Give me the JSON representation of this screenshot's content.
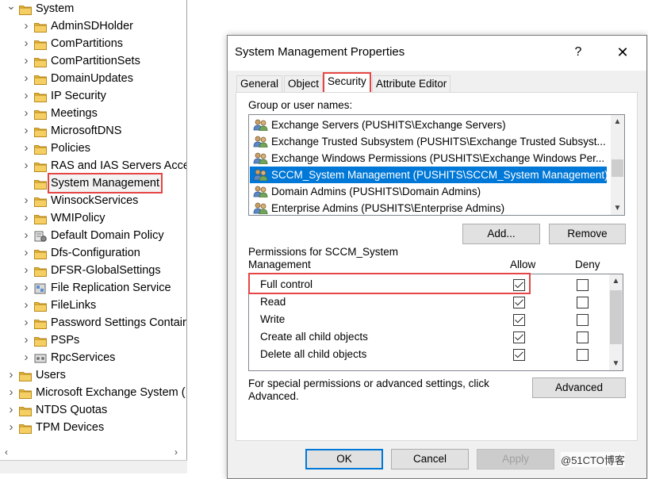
{
  "tree": {
    "items": [
      {
        "label": "System",
        "icon": "folder-icon",
        "expander": "expanded"
      },
      {
        "label": "AdminSDHolder",
        "icon": "folder-icon",
        "expander": "collapsed"
      },
      {
        "label": "ComPartitions",
        "icon": "folder-icon",
        "expander": "collapsed"
      },
      {
        "label": "ComPartitionSets",
        "icon": "folder-icon",
        "expander": "collapsed"
      },
      {
        "label": "DomainUpdates",
        "icon": "folder-icon",
        "expander": "collapsed"
      },
      {
        "label": "IP Security",
        "icon": "folder-icon",
        "expander": "collapsed"
      },
      {
        "label": "Meetings",
        "icon": "folder-icon",
        "expander": "collapsed"
      },
      {
        "label": "MicrosoftDNS",
        "icon": "folder-icon",
        "expander": "collapsed"
      },
      {
        "label": "Policies",
        "icon": "folder-icon",
        "expander": "collapsed"
      },
      {
        "label": "RAS and IAS Servers Acce",
        "icon": "folder-icon",
        "expander": "collapsed"
      },
      {
        "label": "System Management",
        "icon": "folder-icon",
        "expander": "none",
        "selected": true
      },
      {
        "label": "WinsockServices",
        "icon": "folder-icon",
        "expander": "collapsed"
      },
      {
        "label": "WMIPolicy",
        "icon": "folder-icon",
        "expander": "collapsed"
      },
      {
        "label": "Default Domain Policy",
        "icon": "policy-icon",
        "expander": "collapsed"
      },
      {
        "label": "Dfs-Configuration",
        "icon": "folder-icon",
        "expander": "collapsed"
      },
      {
        "label": "DFSR-GlobalSettings",
        "icon": "folder-icon",
        "expander": "collapsed"
      },
      {
        "label": "File Replication Service",
        "icon": "replication-icon",
        "expander": "collapsed"
      },
      {
        "label": "FileLinks",
        "icon": "folder-icon",
        "expander": "collapsed"
      },
      {
        "label": "Password Settings Contair",
        "icon": "folder-icon",
        "expander": "collapsed"
      },
      {
        "label": "PSPs",
        "icon": "folder-icon",
        "expander": "collapsed"
      },
      {
        "label": "RpcServices",
        "icon": "rpc-icon",
        "expander": "collapsed"
      },
      {
        "label": "Users",
        "icon": "folder-icon",
        "expander": "collapsed"
      },
      {
        "label": "Microsoft Exchange System (",
        "icon": "folder-icon",
        "expander": "collapsed"
      },
      {
        "label": "NTDS Quotas",
        "icon": "folder-icon",
        "expander": "collapsed"
      },
      {
        "label": "TPM Devices",
        "icon": "folder-icon",
        "expander": "collapsed"
      }
    ]
  },
  "dialog": {
    "title": "System Management Properties",
    "help_label": "?",
    "close_label": "✕",
    "tabs": [
      {
        "label": "General"
      },
      {
        "label": "Object"
      },
      {
        "label": "Security",
        "active": true
      },
      {
        "label": "Attribute Editor"
      }
    ],
    "groups_label": "Group or user names:",
    "groups": [
      {
        "label": "Exchange Servers (PUSHITS\\Exchange Servers)"
      },
      {
        "label": "Exchange Trusted Subsystem (PUSHITS\\Exchange Trusted Subsyst..."
      },
      {
        "label": "Exchange Windows Permissions (PUSHITS\\Exchange Windows Per..."
      },
      {
        "label": "SCCM_System Management (PUSHITS\\SCCM_System Management)",
        "selected": true
      },
      {
        "label": "Domain Admins (PUSHITS\\Domain Admins)"
      },
      {
        "label": "Enterprise Admins (PUSHITS\\Enterprise Admins)"
      }
    ],
    "add_label": "Add...",
    "remove_label": "Remove",
    "perm_label_line1": "Permissions for SCCM_System",
    "perm_label_line2": "Management",
    "allow_header": "Allow",
    "deny_header": "Deny",
    "permissions": [
      {
        "name": "Full control",
        "allow": true,
        "deny": false
      },
      {
        "name": "Read",
        "allow": true,
        "deny": false
      },
      {
        "name": "Write",
        "allow": true,
        "deny": false
      },
      {
        "name": "Create all child objects",
        "allow": true,
        "deny": false
      },
      {
        "name": "Delete all child objects",
        "allow": true,
        "deny": false
      }
    ],
    "special_text_line1": "For special permissions or advanced settings, click",
    "special_text_line2": "Advanced.",
    "advanced_label": "Advanced",
    "ok_label": "OK",
    "cancel_label": "Cancel",
    "apply_label": "Apply"
  },
  "watermark": "@51CTO博客",
  "colors": {
    "highlight_box": "#e64545",
    "selection": "#0078d7",
    "folder": "#e8b93c"
  }
}
